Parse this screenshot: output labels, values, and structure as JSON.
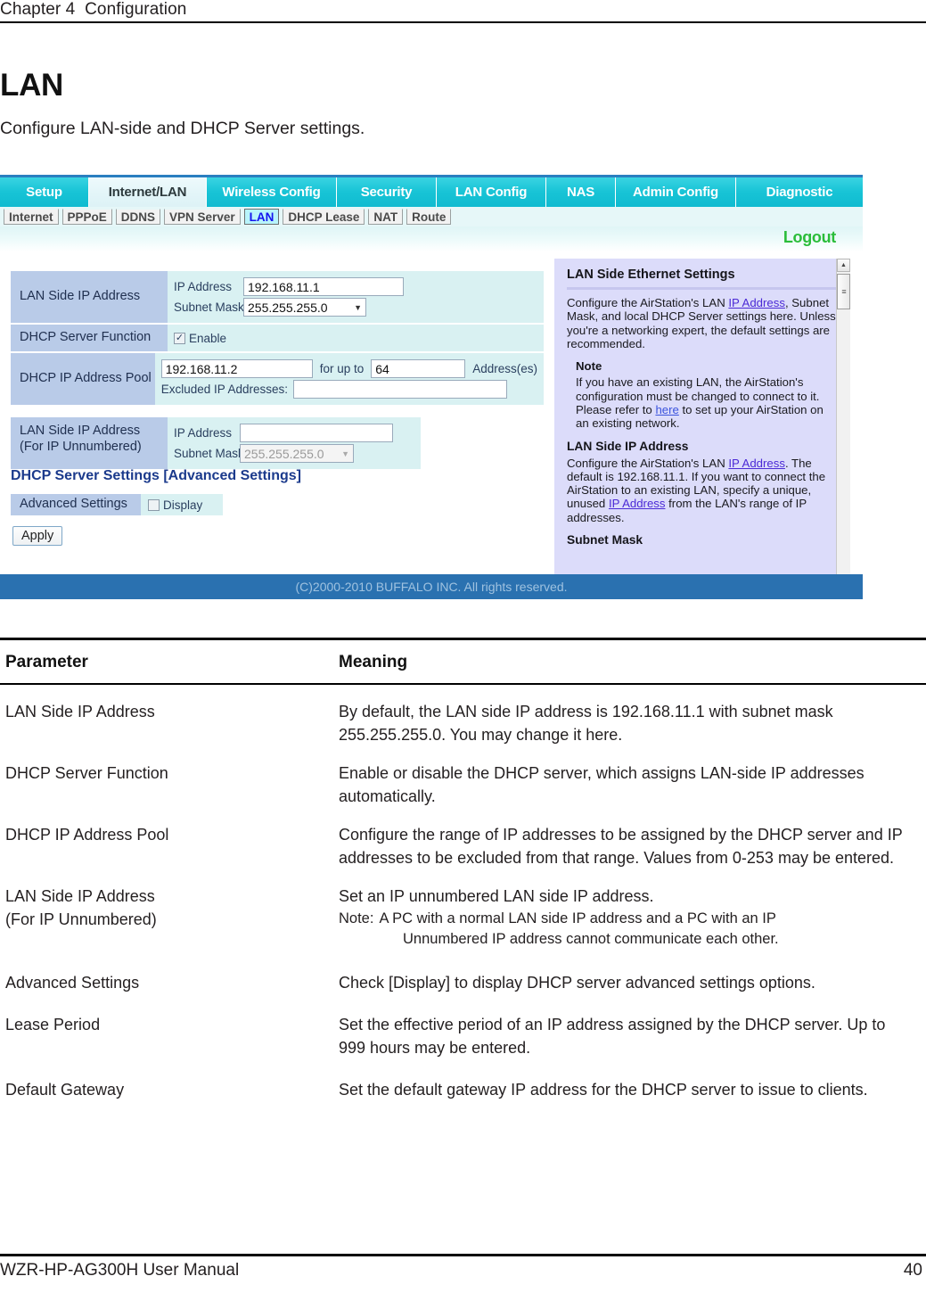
{
  "page": {
    "chapter": "Chapter 4  Configuration",
    "title": "LAN",
    "intro": "Configure LAN-side and DHCP Server settings.",
    "footer_left": "WZR-HP-AG300H User Manual",
    "footer_page": "40"
  },
  "screenshot": {
    "main_tabs": [
      {
        "label": "Setup",
        "active": false
      },
      {
        "label": "Internet/LAN",
        "active": true
      },
      {
        "label": "Wireless Config",
        "active": false
      },
      {
        "label": "Security",
        "active": false
      },
      {
        "label": "LAN Config",
        "active": false
      },
      {
        "label": "NAS",
        "active": false
      },
      {
        "label": "Admin Config",
        "active": false
      },
      {
        "label": "Diagnostic",
        "active": false
      }
    ],
    "sub_tabs": [
      {
        "label": "Internet",
        "active": false
      },
      {
        "label": "PPPoE",
        "active": false
      },
      {
        "label": "DDNS",
        "active": false
      },
      {
        "label": "VPN Server",
        "active": false
      },
      {
        "label": "LAN",
        "active": true
      },
      {
        "label": "DHCP Lease",
        "active": false
      },
      {
        "label": "NAT",
        "active": false
      },
      {
        "label": "Route",
        "active": false
      }
    ],
    "logout_label": "Logout",
    "form": {
      "lan_side_ip": {
        "label": "LAN Side IP Address",
        "ip_label": "IP Address",
        "ip_value": "192.168.11.1",
        "mask_label": "Subnet Mask",
        "mask_value": "255.255.255.0"
      },
      "dhcp_server_function": {
        "label": "DHCP Server Function",
        "enable_label": "Enable",
        "enabled": true
      },
      "dhcp_pool": {
        "label": "DHCP IP Address Pool",
        "start_value": "192.168.11.2",
        "for_up_to_label": "for up to",
        "count_value": "64",
        "addresses_label": "Address(es)",
        "excluded_label": "Excluded IP Addresses:",
        "excluded_value": ""
      },
      "lan_side_ip_unnumbered": {
        "label_line1": "LAN Side IP Address",
        "label_line2": "(For IP Unnumbered)",
        "ip_label": "IP Address",
        "ip_value": "",
        "mask_label": "Subnet Mask",
        "mask_value": "255.255.255.0"
      },
      "advanced_section_title": "DHCP Server Settings [Advanced Settings]",
      "advanced_settings": {
        "label": "Advanced Settings",
        "display_label": "Display",
        "checked": false
      },
      "apply_label": "Apply"
    },
    "help": {
      "title": "LAN Side Ethernet Settings",
      "intro_a": "Configure the AirStation's LAN ",
      "intro_link": "IP Address",
      "intro_b": ", Subnet Mask, and local DHCP Server settings here. Unless you're a networking expert, the default settings are recommended.",
      "note_heading": "Note",
      "note_a": "If you have an existing LAN, the AirStation's configuration must be changed to connect to it. Please refer to ",
      "note_link": "here",
      "note_b": " to set up your AirStation on an existing network.",
      "lan_ip_heading": "LAN Side IP Address",
      "lan_ip_a": "Configure the AirStation's LAN ",
      "lan_ip_link1": "IP Address",
      "lan_ip_b": ". The default is 192.168.11.1. If you want to connect the AirStation to an existing LAN, specify a unique, unused ",
      "lan_ip_link2": "IP Address",
      "lan_ip_c": " from the LAN's range of IP addresses.",
      "subnet_heading": "Subnet Mask"
    },
    "copyright": "(C)2000-2010 BUFFALO INC. All rights reserved."
  },
  "table": {
    "header": {
      "parameter": "Parameter",
      "meaning": "Meaning"
    },
    "rows": [
      {
        "parameter": "LAN Side IP Address",
        "meaning": "By default, the LAN side IP address is 192.168.11.1 with subnet mask 255.255.255.0.  You may change it here."
      },
      {
        "parameter": "DHCP Server Function",
        "meaning": "Enable or disable the DHCP server, which assigns LAN-side IP addresses automatically."
      },
      {
        "parameter": "DHCP IP Address Pool",
        "meaning": "Configure the range of IP addresses to be assigned by the DHCP server and IP addresses to be excluded from that range. Values from 0-253 may be entered."
      },
      {
        "parameter_line1": "LAN Side IP Address",
        "parameter_line2": "(For IP Unnumbered)",
        "meaning": "Set an IP unnumbered LAN side IP address.",
        "note_label": "Note:",
        "note_line1": "A PC with a normal LAN side IP address and a PC with an IP",
        "note_line2": "Unnumbered IP address cannot communicate each other."
      },
      {
        "parameter": "Advanced Settings",
        "meaning": "Check [Display] to display DHCP server advanced settings options."
      },
      {
        "parameter": "Lease Period",
        "meaning": "Set the effective period of an IP address assigned by the DHCP server. Up to 999 hours may be entered."
      },
      {
        "parameter": "Default Gateway",
        "meaning": "Set the default gateway IP address for the DHCP server to issue to clients."
      }
    ]
  }
}
